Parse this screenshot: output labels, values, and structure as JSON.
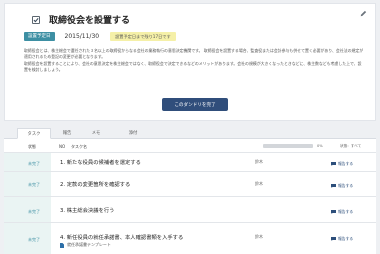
{
  "task": {
    "title": "取締役会を設置する",
    "due_label": "設置予定日",
    "due_date": "2015/11/30",
    "due_chip": "設置予定日まで残り17日です",
    "description": [
      "取締役会とは、株主総会で選任された３名以上の取締役からなる会社の業務執行の意思決定機関です。 取締役会を設置する場合、監査役または会計参与も併せて置く必要があり、会社法の規定が適用されるため登記の変更が必要となります。",
      "取締役会を設置することにより、会社の意思決定を株主総会ではなく、取締役会で決定できるなどのメリットがあります。会社の規模が大きくなったときなどに、株主数なども考慮した上で、設置を検討しましょう。"
    ],
    "complete_button": "このダンドリを完了"
  },
  "tabs": [
    {
      "label": "タスク",
      "active": true
    },
    {
      "label": "報告",
      "active": false
    },
    {
      "label": "メモ",
      "active": false
    },
    {
      "label": "添付",
      "active": false
    }
  ],
  "table": {
    "headers": {
      "status": "状態",
      "no": "NO",
      "name": "タスク名"
    },
    "progress": {
      "percent": 0,
      "text": "0%"
    },
    "filter_label": "状態：すべて",
    "rows": [
      {
        "status": "未完了",
        "name": "1. 新たな役員の候補者を選定する",
        "assignee": "鈴木",
        "comment": "報告する"
      },
      {
        "status": "未完了",
        "name": "2. 定款の変更箇所を確認する",
        "assignee": "鈴木",
        "comment": "報告する"
      },
      {
        "status": "未完了",
        "name": "3. 株主総会決議を行う",
        "assignee": "",
        "comment": "報告する"
      },
      {
        "status": "未完了",
        "name": "4. 新任役員の就任承諾書、本人確認書類を入手する",
        "assignee": "鈴木",
        "comment": "報告する",
        "link": "就任承諾書テンプレート"
      }
    ]
  }
}
